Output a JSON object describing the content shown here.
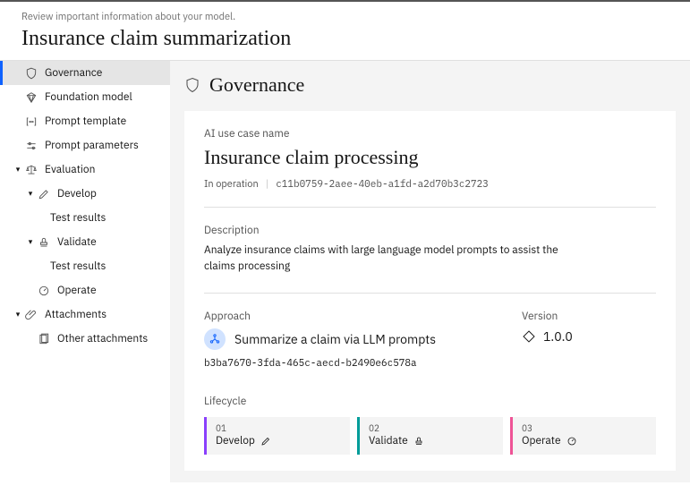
{
  "header": {
    "subtitle": "Review important information about your model.",
    "title": "Insurance claim summarization"
  },
  "sidebar": {
    "items": [
      {
        "label": "Governance"
      },
      {
        "label": "Foundation model"
      },
      {
        "label": "Prompt template"
      },
      {
        "label": "Prompt parameters"
      },
      {
        "label": "Evaluation"
      },
      {
        "label": "Develop"
      },
      {
        "label": "Test results"
      },
      {
        "label": "Validate"
      },
      {
        "label": "Test results"
      },
      {
        "label": "Operate"
      },
      {
        "label": "Attachments"
      },
      {
        "label": "Other attachments"
      }
    ]
  },
  "main": {
    "section_title": "Governance",
    "usecase_label": "AI use case name",
    "usecase_name": "Insurance claim processing",
    "usecase_status": "In operation",
    "usecase_id": "c11b0759-2aee-40eb-a1fd-a2d70b3c2723",
    "description_label": "Description",
    "description_text": "Analyze insurance claims with large language model prompts to assist the claims processing",
    "approach_label": "Approach",
    "approach_name": "Summarize a claim via LLM prompts",
    "approach_id": "b3ba7670-3fda-465c-aecd-b2490e6c578a",
    "version_label": "Version",
    "version_value": "1.0.0",
    "lifecycle_label": "Lifecycle",
    "lifecycle": [
      {
        "num": "01",
        "name": "Develop"
      },
      {
        "num": "02",
        "name": "Validate"
      },
      {
        "num": "03",
        "name": "Operate"
      }
    ]
  }
}
